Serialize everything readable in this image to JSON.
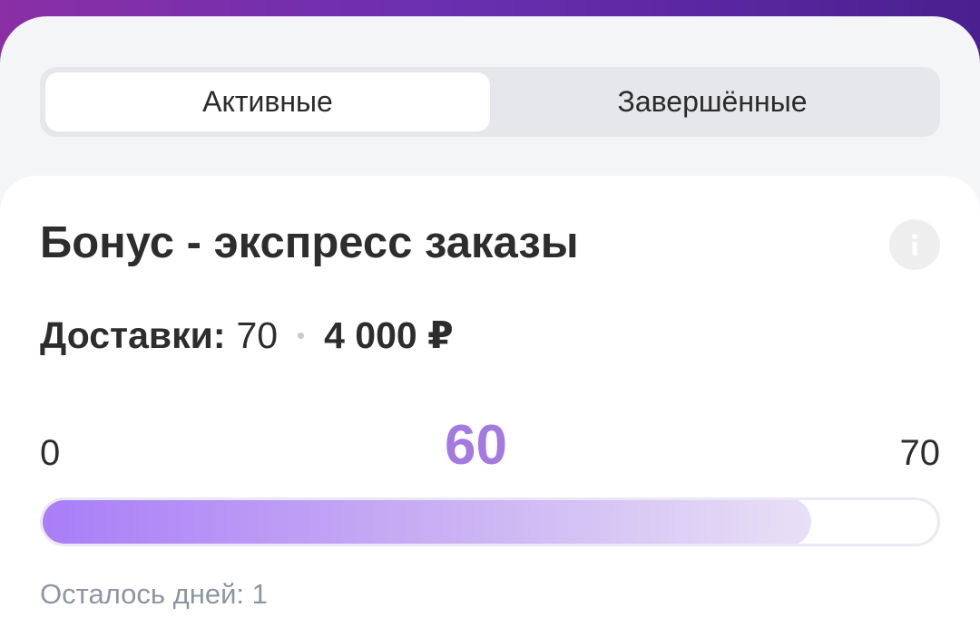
{
  "tabs": {
    "active_label": "Активные",
    "completed_label": "Завершённые",
    "selected": "active"
  },
  "card": {
    "title": "Бонус - экспресс заказы",
    "info_icon": "info-icon",
    "deliveries_label": "Доставки:",
    "deliveries_target": "70",
    "reward": "4 000 ₽",
    "progress": {
      "min": "0",
      "max": "70",
      "current": "60",
      "fraction": 0.857
    },
    "days_left": "Осталось дней: 1"
  },
  "colors": {
    "accent": "#a47ae0",
    "progress_start": "#a97df7",
    "progress_end": "#e8e0f6",
    "muted_text": "#8d95a3"
  }
}
